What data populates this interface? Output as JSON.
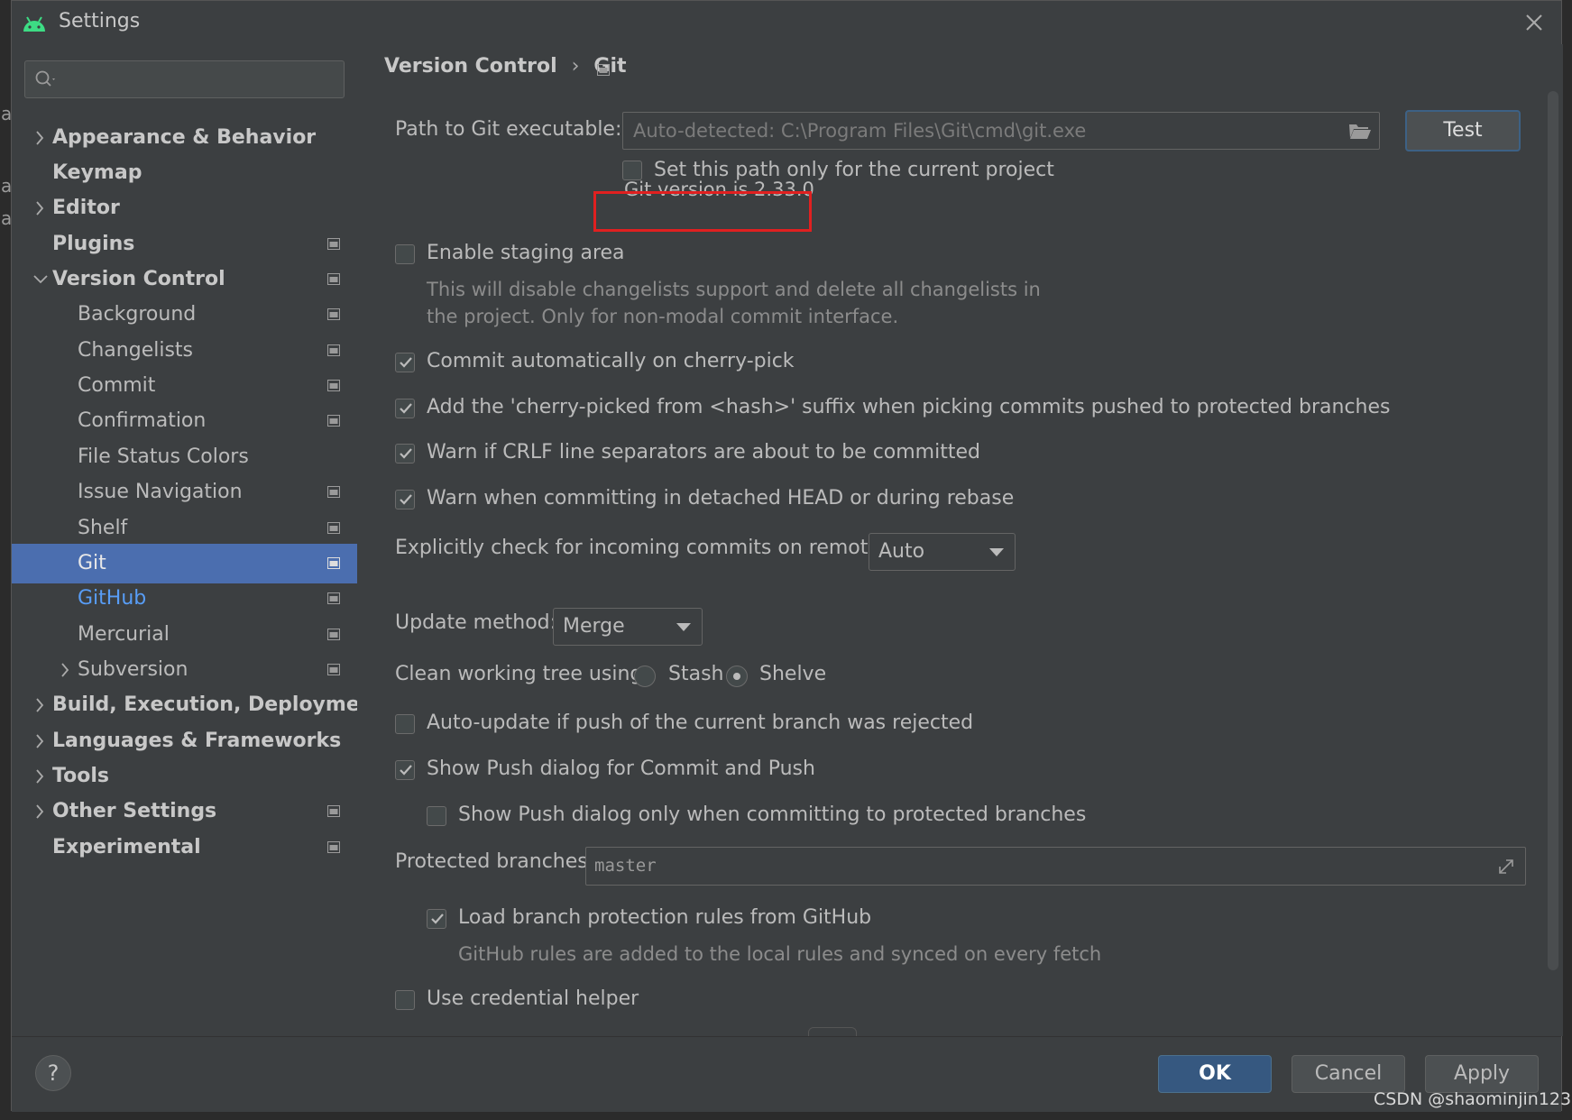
{
  "window": {
    "title": "Settings"
  },
  "search": {
    "placeholder": ""
  },
  "sidebar": {
    "items": [
      {
        "label": "Appearance & Behavior"
      },
      {
        "label": "Keymap"
      },
      {
        "label": "Editor"
      },
      {
        "label": "Plugins"
      },
      {
        "label": "Version Control"
      },
      {
        "label": "Background"
      },
      {
        "label": "Changelists"
      },
      {
        "label": "Commit"
      },
      {
        "label": "Confirmation"
      },
      {
        "label": "File Status Colors"
      },
      {
        "label": "Issue Navigation"
      },
      {
        "label": "Shelf"
      },
      {
        "label": "Git"
      },
      {
        "label": "GitHub"
      },
      {
        "label": "Mercurial"
      },
      {
        "label": "Subversion"
      },
      {
        "label": "Build, Execution, Deployment"
      },
      {
        "label": "Languages & Frameworks"
      },
      {
        "label": "Tools"
      },
      {
        "label": "Other Settings"
      },
      {
        "label": "Experimental"
      }
    ],
    "selected": "Git"
  },
  "breadcrumb": {
    "parent": "Version Control",
    "separator": "›",
    "current": "Git"
  },
  "git": {
    "path_label": "Path to Git executable:",
    "path_value": "Auto-detected: C:\\Program Files\\Git\\cmd\\git.exe",
    "test_button": "Test",
    "current_project_only": "Set this path only for the current project",
    "version_text": "Git version is 2.33.0",
    "staging_label": "Enable staging area",
    "staging_hint_1": "This will disable changelists support and delete all changelists in",
    "staging_hint_2": "the project. Only for non-modal commit interface.",
    "cherry_pick_commit": "Commit automatically on cherry-pick",
    "cherry_pick_suffix": "Add the 'cherry-picked from <hash>' suffix when picking commits pushed to protected branches",
    "warn_crlf": "Warn if CRLF line separators are about to be committed",
    "warn_detached": "Warn when committing in detached HEAD or during rebase",
    "incoming_label": "Explicitly check for incoming commits on remotes:",
    "incoming_value": "Auto",
    "update_method_label": "Update method:",
    "update_method_value": "Merge",
    "clean_tree_label": "Clean working tree using:",
    "stash_label": "Stash",
    "shelve_label": "Shelve",
    "auto_update": "Auto-update if push of the current branch was rejected",
    "show_push": "Show Push dialog for Commit and Push",
    "show_push_protected": "Show Push dialog only when committing to protected branches",
    "protected_label": "Protected branches:",
    "protected_value": "master",
    "load_rules": "Load branch protection rules from GitHub",
    "load_rules_hint": "GitHub rules are added to the local rules and synced on every fetch",
    "credential_helper": "Use credential helper"
  },
  "footer": {
    "help": "?",
    "ok": "OK",
    "cancel": "Cancel",
    "apply": "Apply"
  },
  "background": {
    "side_letters": [
      "a",
      "a",
      "a"
    ]
  },
  "watermark": "CSDN @shaominjin123",
  "colors": {
    "selection": "#4b6eaf",
    "link": "#589df6",
    "highlight": "#e02020",
    "android": "#3ddc84"
  }
}
